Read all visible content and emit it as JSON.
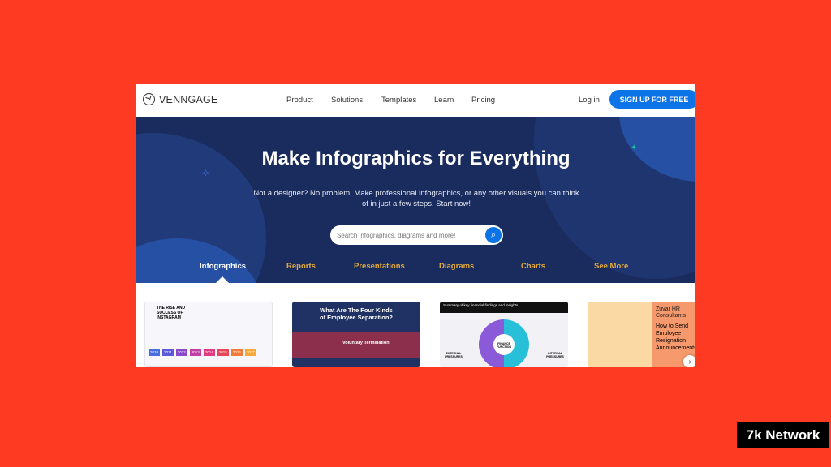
{
  "nav": {
    "brand": "VENNGAGE",
    "links": [
      "Product",
      "Solutions",
      "Templates",
      "Learn",
      "Pricing"
    ],
    "login": "Log in",
    "signup": "SIGN UP FOR FREE"
  },
  "hero": {
    "title": "Make Infographics for Everything",
    "subtitle": "Not a designer? No problem. Make professional infographics, or any other visuals you can think of in just a few steps. Start now!",
    "search_placeholder": "Search infographics, diagrams and more!",
    "tabs": [
      "Infographics",
      "Reports",
      "Presentations",
      "Diagrams",
      "Charts",
      "See More"
    ],
    "active_tab": "Infographics"
  },
  "templates": [
    {
      "title": "THE RISE AND SUCCESS OF INSTAGRAM",
      "years": [
        "2010",
        "2011",
        "2012",
        "2013",
        "2014",
        "2015",
        "2016",
        "2017"
      ]
    },
    {
      "title": "What Are The Four Kinds of Employee Separation?",
      "item": "Voluntary Termination"
    },
    {
      "title": "Summary of key financial findings and insights",
      "center": "FINANCE FUNCTION",
      "left": "EXTERNAL PRESSURES",
      "right": "INTERNAL PRESSURES"
    },
    {
      "company": "Zuvar HR Consultants",
      "title": "How to Send Employee Resignation Announcements"
    }
  ],
  "watermark": "7k Network",
  "colors": {
    "background": "#fe3a22",
    "hero": "#1a2c5e",
    "accent": "#0c74e6",
    "tab": "#e1a937"
  }
}
